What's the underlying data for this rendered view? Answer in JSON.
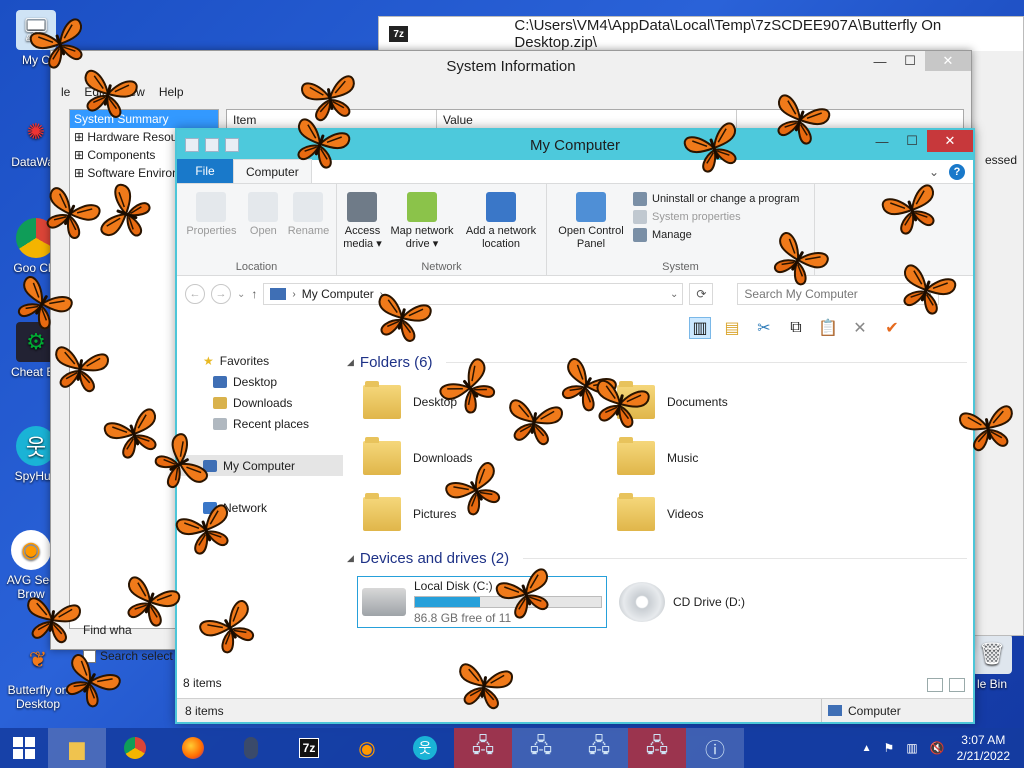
{
  "desktop": {
    "icons": [
      {
        "label": "My C",
        "id": "my-computer"
      },
      {
        "label": "DataWag",
        "id": "datawag"
      },
      {
        "label": "Goo Chr",
        "id": "chrome"
      },
      {
        "label": "Cheat En",
        "id": "cheat-engine"
      },
      {
        "label": "SpyHun",
        "id": "spyhunter"
      },
      {
        "label": "AVG Sec Brow",
        "id": "avg"
      },
      {
        "label": "Butterfly on Desktop",
        "id": "butterfly"
      },
      {
        "label": "le Bin",
        "id": "recycle-bin"
      }
    ]
  },
  "zip_window": {
    "title": "C:\\Users\\VM4\\AppData\\Local\\Temp\\7zSCDEE907A\\Butterfly On Desktop.zip\\",
    "logo": "7z",
    "partial_text": "essed"
  },
  "sysinfo": {
    "title": "System Information",
    "menu": [
      "le",
      "Edit",
      "View",
      "Help"
    ],
    "tree": [
      {
        "label": "System Summary",
        "selected": true
      },
      {
        "label": "Hardware Resources"
      },
      {
        "label": "Components"
      },
      {
        "label": "Software Environment"
      }
    ],
    "columns": [
      "Item",
      "Value"
    ],
    "find_label": "Find wha",
    "search_selected": "Search select"
  },
  "explorer": {
    "title": "My Computer",
    "tabs": {
      "file": "File",
      "computer": "Computer"
    },
    "ribbon": {
      "location": {
        "label": "Location",
        "buttons": [
          {
            "label": "Properties",
            "disabled": true
          },
          {
            "label": "Open",
            "disabled": true
          },
          {
            "label": "Rename",
            "disabled": true
          }
        ]
      },
      "network": {
        "label": "Network",
        "buttons": [
          {
            "label": "Access media ▾"
          },
          {
            "label": "Map network drive ▾"
          },
          {
            "label": "Add a network location"
          }
        ]
      },
      "system": {
        "label": "System",
        "open_cp": "Open Control Panel",
        "small": [
          {
            "label": "Uninstall or change a program",
            "disabled": false
          },
          {
            "label": "System properties",
            "disabled": true
          },
          {
            "label": "Manage",
            "disabled": false
          }
        ]
      }
    },
    "address": {
      "path": "My Computer",
      "search_placeholder": "Search My Computer"
    },
    "nav": {
      "favorites": "Favorites",
      "fav_items": [
        "Desktop",
        "Downloads",
        "Recent places"
      ],
      "computer": "My Computer",
      "network": "Network"
    },
    "folders_header": "Folders (6)",
    "folders": [
      "Desktop",
      "Documents",
      "Downloads",
      "Music",
      "Pictures",
      "Videos"
    ],
    "drives_header": "Devices and drives (2)",
    "drives": [
      {
        "name": "Local Disk (C:)",
        "free": "86.8 GB free of 11",
        "used_fraction": 0.35
      },
      {
        "name": "CD Drive (D:)"
      }
    ],
    "inner_status": "8 items",
    "status_count": "8 items",
    "status_zone": "Computer"
  },
  "taskbar": {
    "items": [
      "explorer",
      "chrome",
      "firefox",
      "mouse",
      "7z",
      "avg",
      "spyhunter",
      "network-red",
      "network",
      "network",
      "network-red",
      "sysinfo"
    ],
    "time": "3:07 AM",
    "date": "2/21/2022"
  },
  "colors": {
    "accent": "#4dc9dc",
    "file_tab": "#1979ca",
    "close_red": "#c7383b",
    "butterfly": "#f07a1a"
  }
}
